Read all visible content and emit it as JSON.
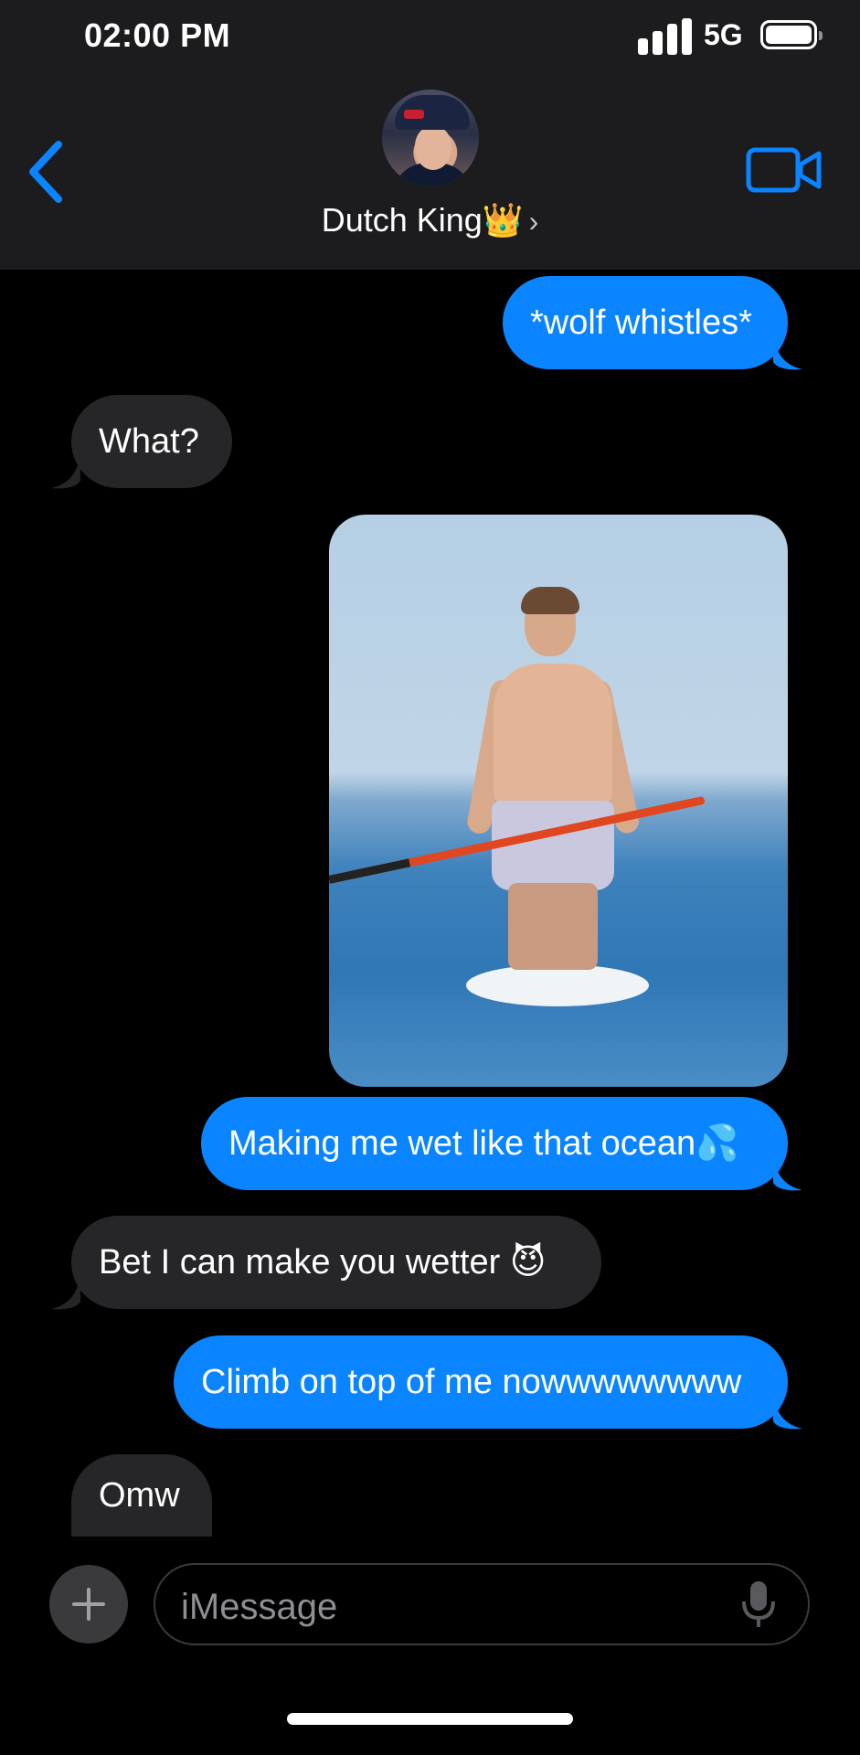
{
  "status_bar": {
    "time": "02:00 PM",
    "network": "5G"
  },
  "header": {
    "contact_name": "Dutch King👑",
    "chevron": "›"
  },
  "messages": [
    {
      "side": "outgoing",
      "text": "*wolf whistles*"
    },
    {
      "side": "incoming",
      "text": "What?"
    },
    {
      "side": "outgoing",
      "type": "photo"
    },
    {
      "side": "outgoing",
      "text": "Making me wet like that ocean💦"
    },
    {
      "side": "incoming",
      "text": "Bet I can make you wetter 😈"
    },
    {
      "side": "outgoing",
      "text": "Climb on top of me nowwwwwwww"
    },
    {
      "side": "incoming",
      "text": "Omw"
    }
  ],
  "input": {
    "placeholder": "iMessage"
  },
  "colors": {
    "outgoing_bubble": "#0a84ff",
    "incoming_bubble": "#262628",
    "accent": "#0a84ff",
    "header_bg": "#1c1c1e"
  },
  "icons": [
    "back-chevron-icon",
    "video-camera-icon",
    "plus-icon",
    "microphone-icon",
    "signal-icon",
    "battery-icon"
  ]
}
